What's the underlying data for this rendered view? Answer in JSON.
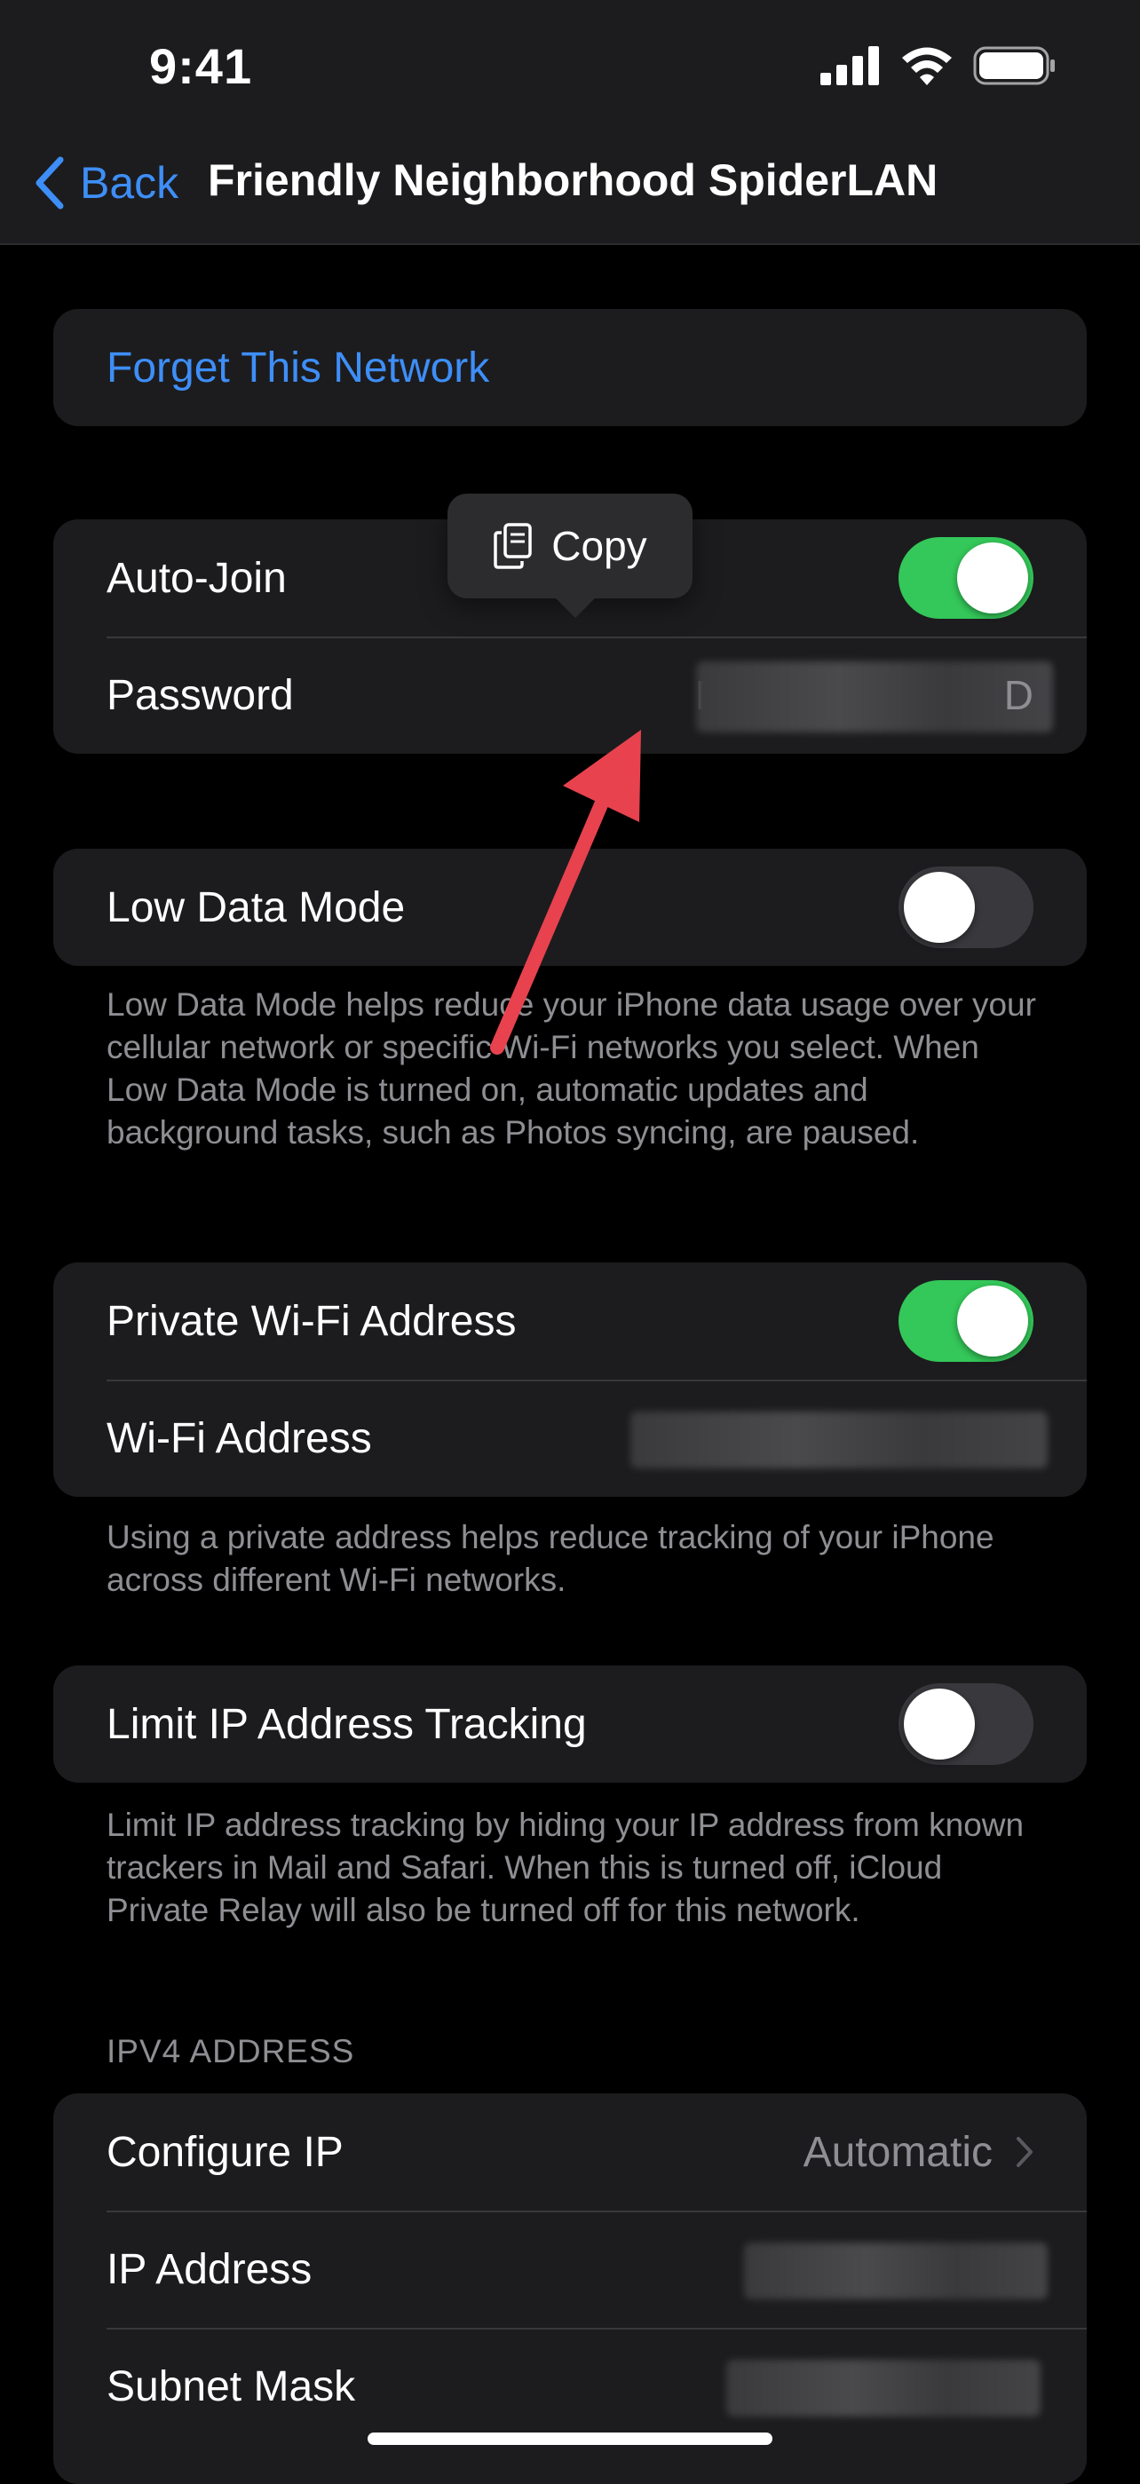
{
  "status": {
    "time": "9:41"
  },
  "nav": {
    "back_label": "Back",
    "title": "Friendly Neighborhood SpiderLAN"
  },
  "forget": {
    "label": "Forget This Network"
  },
  "auto_join": {
    "label": "Auto-Join",
    "enabled": true
  },
  "password": {
    "label": "Password",
    "visible_start": "P#",
    "visible_end": "D"
  },
  "copy_callout": {
    "label": "Copy"
  },
  "low_data": {
    "label": "Low Data Mode",
    "enabled": false,
    "footnote": "Low Data Mode helps reduce your iPhone data usage over your cellular network or specific Wi-Fi networks you select. When Low Data Mode is turned on, automatic updates and background tasks, such as Photos syncing, are paused."
  },
  "private_address": {
    "label": "Private Wi-Fi Address",
    "enabled": true,
    "wifi_address_label": "Wi-Fi Address",
    "footnote": "Using a private address helps reduce tracking of your iPhone across different Wi-Fi networks."
  },
  "limit_ip": {
    "label": "Limit IP Address Tracking",
    "enabled": false,
    "footnote": "Limit IP address tracking by hiding your IP address from known trackers in Mail and Safari. When this is turned off, iCloud Private Relay will also be turned off for this network."
  },
  "ipv4": {
    "header": "IPV4 ADDRESS",
    "configure_label": "Configure IP",
    "configure_value": "Automatic",
    "ip_label": "IP Address",
    "subnet_label": "Subnet Mask"
  },
  "colors": {
    "accent": "#3e8ef7",
    "toggle_on": "#34c759",
    "annotation_arrow": "#e8424f"
  },
  "icons": [
    "chevron-left-icon",
    "cellular-signal-icon",
    "wifi-icon",
    "battery-icon",
    "copy-icon",
    "chevron-right-icon",
    "annotation-arrow-icon"
  ]
}
